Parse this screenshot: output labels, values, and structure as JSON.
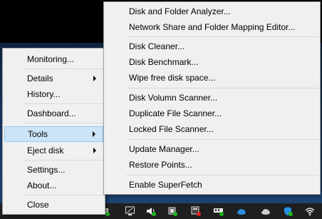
{
  "main_menu": {
    "items": [
      {
        "label": "Monitoring..."
      },
      {
        "label": "Details"
      },
      {
        "label": "History..."
      },
      {
        "label": "Dashboard..."
      },
      {
        "label": "Tools"
      },
      {
        "label": "Eject disk"
      },
      {
        "label": "Settings..."
      },
      {
        "label": "About..."
      },
      {
        "label": "Close"
      }
    ]
  },
  "tools_submenu": {
    "items": [
      {
        "label": "Disk and Folder Analyzer..."
      },
      {
        "label": "Network Share and Folder Mapping Editor..."
      },
      {
        "label": "Disk Cleaner..."
      },
      {
        "label": "Disk Benchmark..."
      },
      {
        "label": "Wipe free disk space..."
      },
      {
        "label": "Disk Volumn Scanner..."
      },
      {
        "label": "Duplicate File Scanner..."
      },
      {
        "label": "Locked File Scanner..."
      },
      {
        "label": "Update Manager..."
      },
      {
        "label": "Restore Points..."
      },
      {
        "label": "Enable SuperFetch"
      }
    ]
  },
  "taskbar": {
    "tray_icons": [
      "harddisk-check-icon",
      "monitor-check-icon",
      "speaker-check-icon",
      "chip-check-icon",
      "card-error-icon",
      "ram-check-icon",
      "cloud-icon",
      "cloud-grey-icon",
      "shield-icon",
      "wifi-icon"
    ]
  },
  "colors": {
    "menu_bg": "#f0f0f0",
    "highlight_bg": "#cce4f7",
    "highlight_border": "#99c9ef",
    "separator": "#d7d7d7",
    "badge_green": "#1fb51f",
    "badge_red": "#e32020",
    "cloud_blue": "#2a8fe0"
  }
}
